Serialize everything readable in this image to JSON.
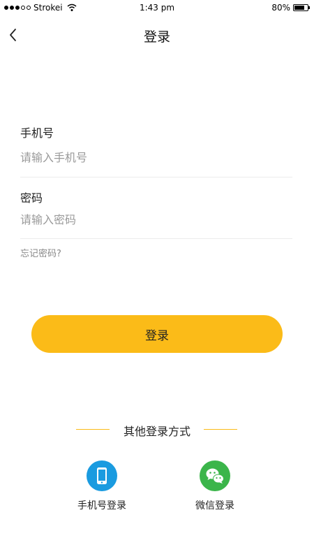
{
  "status_bar": {
    "carrier": "Strokei",
    "time": "1:43 pm",
    "battery_percent": "80%",
    "battery_level": 0.8,
    "signal_bars_filled": 3,
    "signal_bars_total": 5
  },
  "nav": {
    "title": "登录",
    "back_icon": "chevron-left-icon"
  },
  "form": {
    "phone_label": "手机号",
    "phone_placeholder": "请输入手机号",
    "phone_value": "",
    "password_label": "密码",
    "password_placeholder": "请输入密码",
    "password_value": "",
    "forgot_label": "忘记密码?"
  },
  "login_button_label": "登录",
  "colors": {
    "accent": "#fbbb18",
    "phone_icon_bg": "#1a9be0",
    "wechat_icon_bg": "#3bb54a"
  },
  "other_login": {
    "title": "其他登录方式",
    "options": [
      {
        "label": "手机号登录",
        "icon": "mobile-phone-icon"
      },
      {
        "label": "微信登录",
        "icon": "wechat-icon"
      }
    ]
  }
}
